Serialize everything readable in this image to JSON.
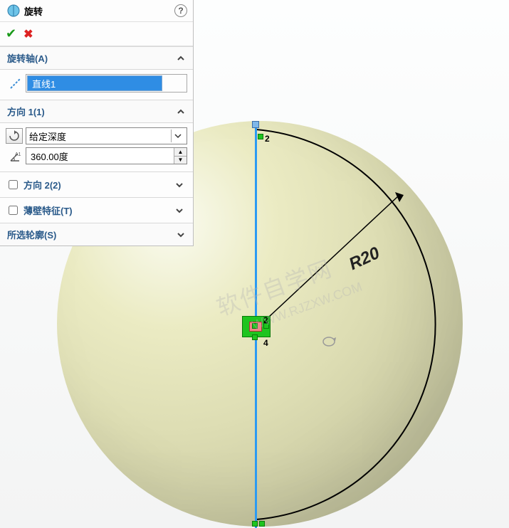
{
  "header": {
    "title": "旋转",
    "ok_tooltip": "确定",
    "cancel_tooltip": "取消",
    "help_char": "?"
  },
  "groups": {
    "axis": {
      "title": "旋转轴(A)",
      "selection": "直线1"
    },
    "dir1": {
      "title": "方向 1(1)",
      "type_value": "给定深度",
      "angle_value": "360.00度"
    },
    "dir2": {
      "title": "方向 2(2)"
    },
    "thin": {
      "title": "薄壁特征(T)"
    },
    "contours": {
      "title": "所选轮廓(S)"
    }
  },
  "viewport": {
    "dim_label": "R20",
    "pt_label_2": "2",
    "pt_label_4": "4",
    "watermark_main": "软件自学网",
    "watermark_sub": "WWW.RJZXW.COM"
  }
}
